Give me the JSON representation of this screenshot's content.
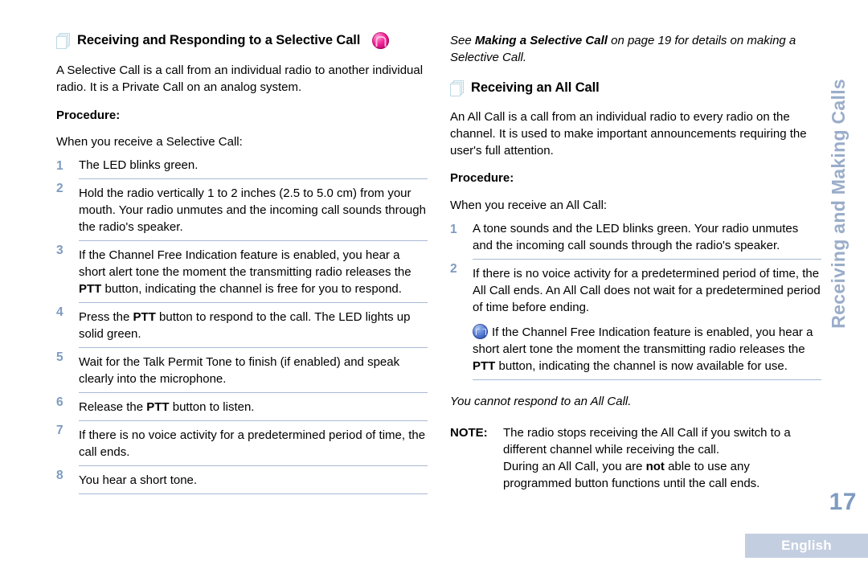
{
  "document": {
    "side_tab_label": "Receiving and Making Calls",
    "page_number": "17",
    "language_label": "English",
    "accent_color": "#7e9bc0",
    "rule_color": "#a9b9d4",
    "footer_bar_color": "#c3cee0",
    "badge_icon_color": "#f5279a",
    "pulse_icon_color": "#2f54b0"
  },
  "left_column": {
    "heading": "Receiving and Responding to a Selective Call",
    "heading_icon": "stacked-pages-icon",
    "heading_badge_icon": "selective-call-badge-icon",
    "intro": "A Selective Call is a call from an individual radio to another individual radio. It is a Private Call on an analog system.",
    "procedure_label": "Procedure:",
    "lead_in": "When you receive a Selective Call:",
    "steps": [
      {
        "num": "1",
        "text": "The LED blinks green."
      },
      {
        "num": "2",
        "text": "Hold the radio vertically 1 to 2 inches (2.5 to 5.0 cm) from your mouth. Your radio unmutes and the incoming call sounds through the radio's speaker."
      },
      {
        "num": "3",
        "text_before": "If the Channel Free Indication feature is enabled, you hear a short alert tone the moment the transmitting radio releases the ",
        "bold": "PTT",
        "text_after": " button, indicating the channel is free for you to respond."
      },
      {
        "num": "4",
        "text_before": "Press the ",
        "bold": "PTT",
        "text_after": " button to respond to the call. The LED lights up solid green."
      },
      {
        "num": "5",
        "text": "Wait for the Talk Permit Tone to finish (if enabled) and speak clearly into the microphone."
      },
      {
        "num": "6",
        "text_before": "Release the ",
        "bold": "PTT",
        "text_after": " button to listen."
      },
      {
        "num": "7",
        "text": "If there is no voice activity for a predetermined period of time, the call ends."
      },
      {
        "num": "8",
        "text": "You hear a short tone."
      }
    ]
  },
  "right_column": {
    "cross_reference": {
      "before": "See ",
      "bold": "Making a Selective Call",
      "after": " on page 19 for details on making a Selective Call."
    },
    "heading": "Receiving an All Call",
    "heading_icon": "stacked-pages-icon",
    "intro": "An All Call is a call from an individual radio to every radio on the channel. It is used to make important announcements requiring the user's full attention.",
    "procedure_label": "Procedure:",
    "lead_in": "When you receive an All Call:",
    "steps": [
      {
        "num": "1",
        "text": "A tone sounds and the LED blinks green. Your radio unmutes and the incoming call sounds through the radio's speaker."
      },
      {
        "num": "2",
        "text": "If there is no voice activity for a predetermined period of time, the All Call ends. An All Call does not wait for a predetermined period of time before ending.",
        "sub_icon": "channel-free-pulse-icon",
        "sub_before": "If the Channel Free Indication feature is enabled, you hear a short alert tone the moment the transmitting radio releases the ",
        "sub_bold": "PTT",
        "sub_after": " button, indicating the channel is now available for use."
      }
    ],
    "italic_footnote": "You cannot respond to an All Call.",
    "note": {
      "label": "NOTE:",
      "line1": "The radio stops receiving the All Call if you switch to a different channel while receiving the call.",
      "line2_before": "During an All Call, you are ",
      "line2_bold": "not",
      "line2_after": " able to use any programmed button functions until the call ends."
    }
  }
}
